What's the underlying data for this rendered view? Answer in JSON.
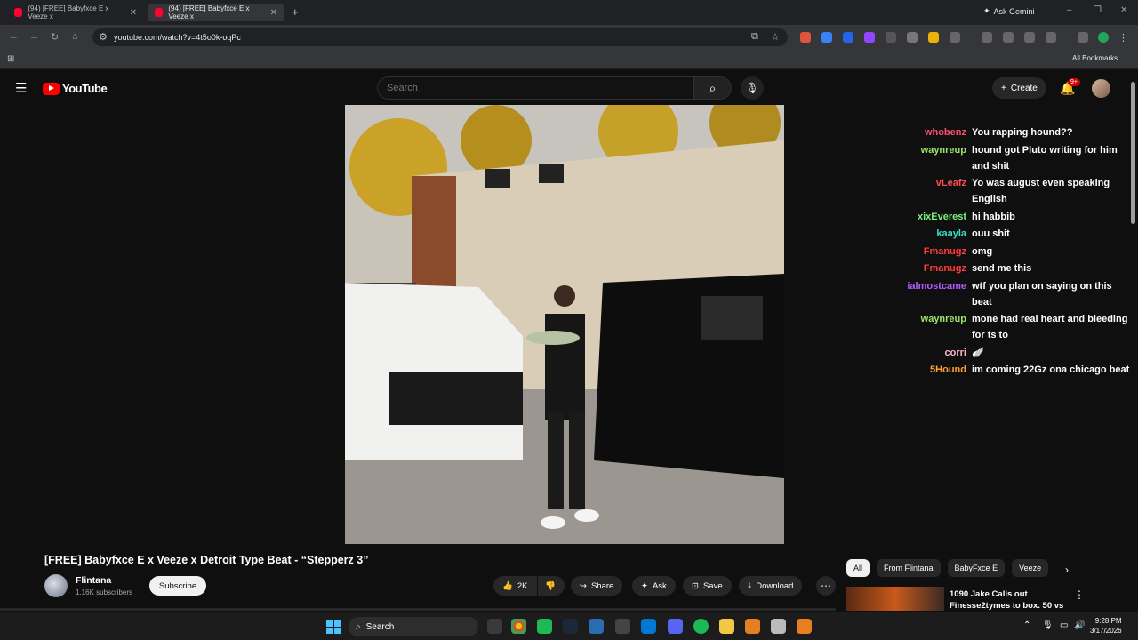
{
  "browser": {
    "tabs": [
      {
        "label": "(94) [FREE] Babyfxce E x Veeze x",
        "active": false
      },
      {
        "label": "(94) [FREE] Babyfxce E x Veeze x",
        "active": true
      }
    ],
    "ask_gemini": "Ask Gemini",
    "url": "youtube.com/watch?v=4t5o0k-oqPc",
    "all_bookmarks": "All Bookmarks"
  },
  "youtube": {
    "logo_text": "YouTube",
    "search_placeholder": "Search",
    "create_label": "Create",
    "notification_count": "9+"
  },
  "chat": [
    {
      "user": "whobenz",
      "color": "#ff4d6d",
      "text": "You rapping hound??"
    },
    {
      "user": "waynreup",
      "color": "#9be36b",
      "text": "hound got Pluto writing for him and shit"
    },
    {
      "user": "vLeafz",
      "color": "#ff4d4d",
      "text": "Yo was august even speaking English"
    },
    {
      "user": "xixEverest",
      "color": "#7cf07c",
      "text": "hi habbib"
    },
    {
      "user": "kaayla",
      "color": "#3de0c4",
      "text": "ouu shit"
    },
    {
      "user": "Fmanugz",
      "color": "#ff3b3b",
      "text": "omg"
    },
    {
      "user": "Fmanugz",
      "color": "#ff3b3b",
      "text": "send me this"
    },
    {
      "user": "ialmostcame",
      "color": "#b25cff",
      "text": "wtf you plan on saying on this beat"
    },
    {
      "user": "waynreup",
      "color": "#9be36b",
      "text": "mone had real heart and bleeding for ts to"
    },
    {
      "user": "corri",
      "color": "#ffb3c7",
      "text": "🪽"
    },
    {
      "user": "5Hound",
      "color": "#ff9f2e",
      "text": "im coming 22Gz ona chicago beat"
    }
  ],
  "video": {
    "title": "[FREE] Babyfxce E x Veeze x Detroit Type Beat - “Stepperz 3”",
    "channel": "Flintana",
    "subscribers": "1.16K subscribers",
    "subscribe_label": "Subscribe",
    "likes": "2K",
    "share_label": "Share",
    "ask_label": "Ask",
    "save_label": "Save",
    "download_label": "Download"
  },
  "chips": [
    "All",
    "From Flintana",
    "BabyFxce E",
    "Veeze"
  ],
  "recommended": {
    "title": "1090 Jake Calls out Finesse2tymes to box. 50 vs ..."
  },
  "taskbar": {
    "search_label": "Search",
    "time": "9:28 PM",
    "date": "3/17/2026"
  }
}
